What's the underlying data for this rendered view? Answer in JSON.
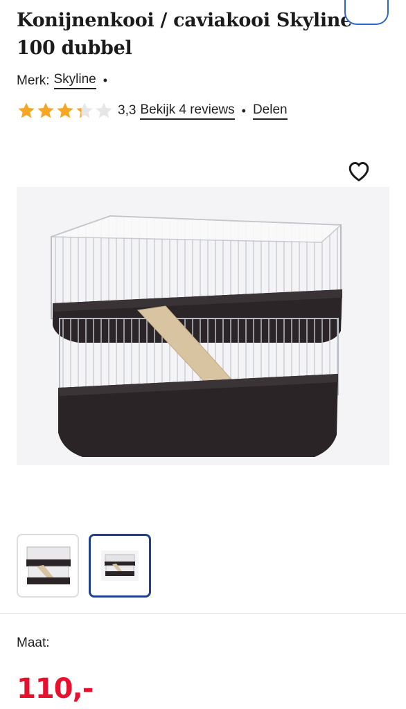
{
  "product": {
    "title": "Konijnenkooi / caviakooi Skyline\n100 dubbel",
    "brand_label": "Merk:",
    "brand_name": "Skyline",
    "rating": 3.3,
    "rating_text": "3,3",
    "reviews_link": "Bekijk 4 reviews",
    "share_link": "Delen",
    "size_label": "Maat:",
    "price": "110,-"
  },
  "colors": {
    "star_filled": "#f5a623",
    "star_empty": "#e6e6e6",
    "price": "#e8112d",
    "thumb_active_border": "#1f3f8f"
  },
  "icons": {
    "favorite": "heart-icon",
    "star": "star-icon"
  }
}
